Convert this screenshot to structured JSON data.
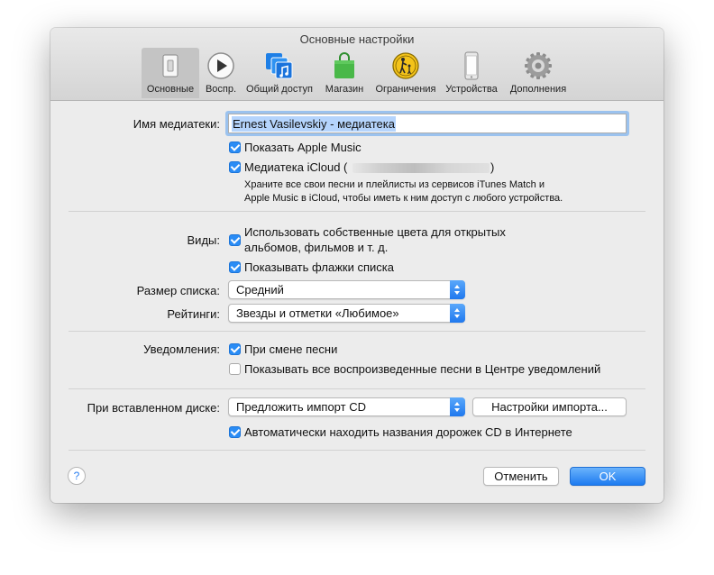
{
  "window": {
    "title": "Основные настройки"
  },
  "toolbar": {
    "items": [
      {
        "label": "Основные",
        "icon": "general-switch-icon",
        "selected": true
      },
      {
        "label": "Воспр.",
        "icon": "play-icon",
        "selected": false
      },
      {
        "label": "Общий доступ",
        "icon": "sharing-icon",
        "selected": false
      },
      {
        "label": "Магазин",
        "icon": "store-bag-icon",
        "selected": false
      },
      {
        "label": "Ограничения",
        "icon": "parental-restrictions-icon",
        "selected": false
      },
      {
        "label": "Устройства",
        "icon": "iphone-icon",
        "selected": false
      },
      {
        "label": "Дополнения",
        "icon": "gear-icon",
        "selected": false
      }
    ]
  },
  "library": {
    "label": "Имя медиатеки:",
    "value": "Ernest Vasilevskiy - медиатека",
    "show_apple_music": {
      "label": "Показать Apple Music",
      "checked": true
    },
    "icloud_library": {
      "label_prefix": "Медиатека iCloud (",
      "label_suffix": ")",
      "checked": true
    },
    "icloud_note_line1": "Храните все свои песни и плейлисты из сервисов iTunes Match и",
    "icloud_note_line2": "Apple Music в iCloud, чтобы иметь к ним доступ с любого устройства."
  },
  "views": {
    "label": "Виды:",
    "custom_colors_line1": "Использовать собственные цвета для открытых",
    "custom_colors_line2": "альбомов, фильмов и т. д.",
    "custom_colors_checked": true,
    "list_checkboxes_label": "Показывать флажки списка",
    "list_checkboxes_checked": true
  },
  "list_size": {
    "label": "Размер списка:",
    "value": "Средний"
  },
  "ratings": {
    "label": "Рейтинги:",
    "value": "Звезды и отметки «Любимое»"
  },
  "notifications": {
    "label": "Уведомления:",
    "song_change": {
      "label": "При смене песни",
      "checked": true
    },
    "show_all": {
      "label": "Показывать все воспроизведенные песни в Центре уведомлений",
      "checked": false
    }
  },
  "cd": {
    "label": "При вставленном диске:",
    "value": "Предложить импорт CD",
    "import_settings_button": "Настройки импорта...",
    "auto_names": {
      "label": "Автоматически находить названия дорожек CD в Интернете",
      "checked": true
    }
  },
  "footer": {
    "help": "?",
    "cancel": "Отменить",
    "ok": "OK"
  },
  "colors": {
    "accent": "#2a8cf5",
    "window_bg": "#ececec"
  }
}
